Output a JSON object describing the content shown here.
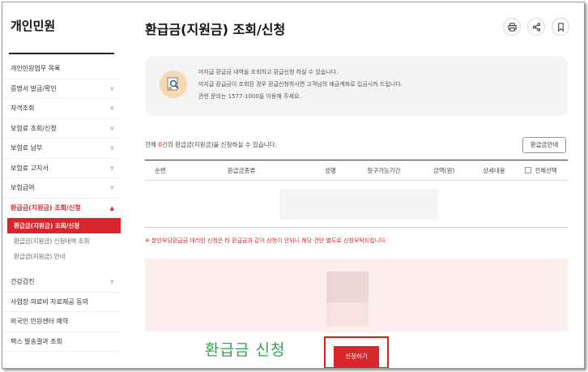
{
  "sidebar": {
    "title": "개인민원",
    "items": [
      {
        "label": "개인민원업무 목록",
        "arrow": ""
      },
      {
        "label": "증명서 발급/확인",
        "arrow": "▼"
      },
      {
        "label": "자격조회",
        "arrow": "▼"
      },
      {
        "label": "보험료 조회/신청",
        "arrow": "▼"
      },
      {
        "label": "보험료 납부",
        "arrow": "▼"
      },
      {
        "label": "보험료 고지서",
        "arrow": "▼"
      },
      {
        "label": "보험급여",
        "arrow": "▼"
      },
      {
        "label": "환급금(지원금) 조회/신청",
        "arrow": "▲"
      }
    ],
    "sub_items": [
      {
        "label": "환급금(지원금) 조회/신청"
      },
      {
        "label": "환급금(지원금) 신청내역 조회"
      },
      {
        "label": "환급금(지원금) 안내"
      }
    ],
    "items_after": [
      {
        "label": "건강검진",
        "arrow": "▼"
      },
      {
        "label": "사업장 의료비 자료제공 동의",
        "arrow": ""
      },
      {
        "label": "외국인 민원센터 예약",
        "arrow": ""
      },
      {
        "label": "팩스 발송결과 조회",
        "arrow": ""
      }
    ]
  },
  "header": {
    "title": "환급금(지원금) 조회/신청",
    "icons": [
      "print-icon",
      "share-icon",
      "bookmark-icon"
    ]
  },
  "info": {
    "line1": "미지급 환급금 내역을 조회하고 환급신청 하실 수 있습니다.",
    "line2": "미지급 환급금이 조회된 경우 환급신청하시면 고객님의 예금계좌로 입금시켜 드립니다.",
    "line3": "관련 문의는 1577-1000을 이용해 주세요."
  },
  "summary": {
    "prefix": "전체 ",
    "count": "0건",
    "suffix": "의 환급금(지원금)을 신청하실 수 있습니다."
  },
  "guide_button": "환급금안내",
  "table": {
    "columns": [
      "순번",
      "환급금종류",
      "성명",
      "청구가능기간",
      "금액(원)",
      "상세내용",
      "전체선택"
    ]
  },
  "notice": "※ 본인부담환급금 대리인 신청은 타 환급금과 같이 신청이 안되니 해당 건만 별도로 신청부탁드립니다.",
  "annotation": "환급금 신청",
  "apply_button": "신청하기",
  "colors": {
    "accent": "#d8262c",
    "annotation": "#2fa44f",
    "info_bg": "#f4f4f4",
    "pink_bg": "#fceeee"
  }
}
